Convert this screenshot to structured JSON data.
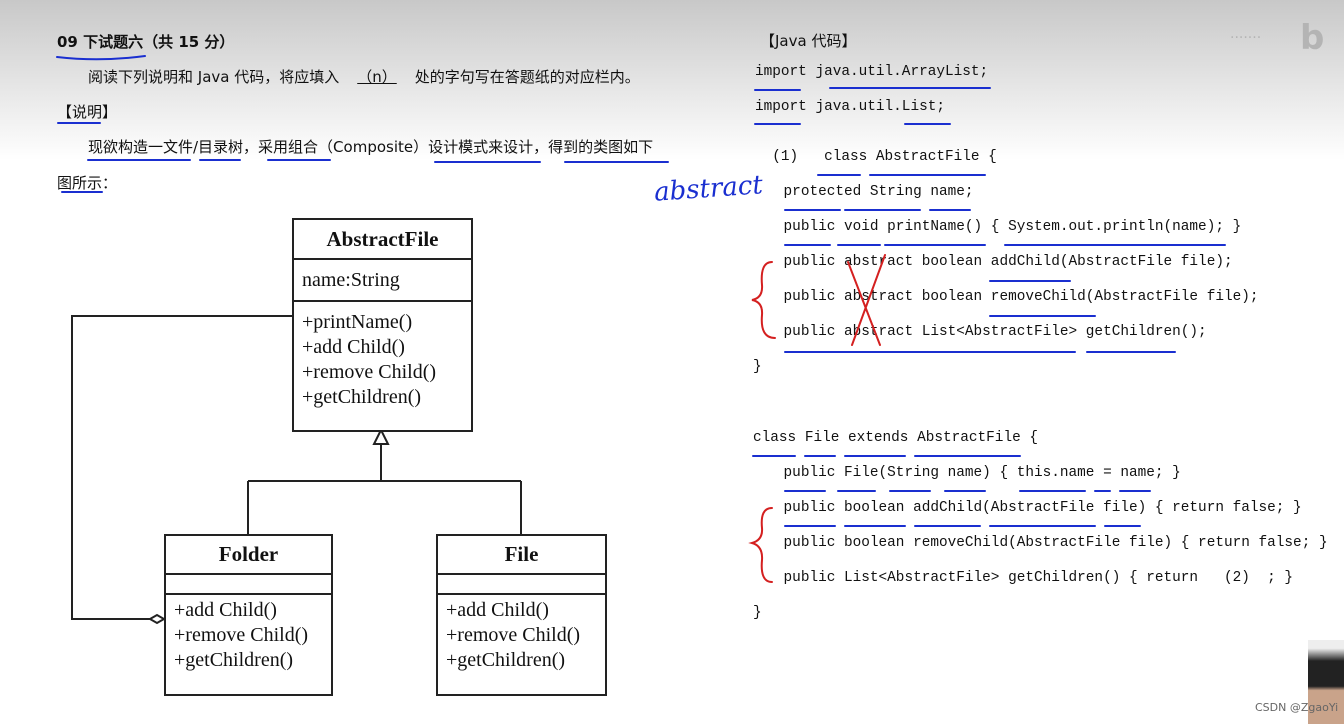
{
  "question": {
    "title": "09 下试题六（共 15 分）",
    "instruction_pre": "阅读下列说明和 Java 代码，将应填入",
    "instruction_blank": "（n）",
    "instruction_post": "处的字句写在答题纸的对应栏内。",
    "section": "【说明】",
    "desc_line1": "现欲构造一文件/目录树，采用组合（Composite）设计模式来设计，得到的类图如下",
    "desc_line2": "图所示："
  },
  "handwriting": {
    "note": "abstract"
  },
  "uml": {
    "abstract_file": {
      "name": "AbstractFile",
      "attr": "name:String",
      "methods": [
        "+printName()",
        "+add Child()",
        "+remove Child()",
        "+getChildren()"
      ]
    },
    "folder": {
      "name": "Folder",
      "methods": [
        "+add Child()",
        "+remove Child()",
        "+getChildren()"
      ]
    },
    "file": {
      "name": "File",
      "methods": [
        "+add Child()",
        "+remove Child()",
        "+getChildren()"
      ]
    }
  },
  "code": {
    "title": "【Java 代码】",
    "lines": [
      "import java.util.ArrayList;",
      "import java.util.List;",
      "  (1)   class AbstractFile {",
      "    protected String name;",
      "    public void printName() { System.out.println(name); }",
      "    public abstract boolean addChild(AbstractFile file);",
      "    public abstract boolean removeChild(AbstractFile file);",
      "    public abstract List<AbstractFile> getChildren();",
      "}",
      "class File extends AbstractFile {",
      "    public File(String name) { this.name = name; }",
      "    public boolean addChild(AbstractFile file) { return false; }",
      "    public boolean removeChild(AbstractFile file) { return false; }",
      "    public List<AbstractFile> getChildren() { return   (2)  ; }",
      "}"
    ]
  },
  "watermark": {
    "logo": "bili",
    "credit": "CSDN @ZgaoYi"
  },
  "colors": {
    "pen_blue": "#1a2fd0",
    "pen_red": "#d42020"
  }
}
